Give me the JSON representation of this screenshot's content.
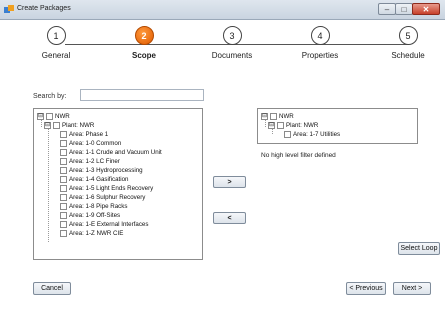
{
  "window": {
    "title": "Create Packages"
  },
  "steps": [
    {
      "number": "1",
      "label": "General"
    },
    {
      "number": "2",
      "label": "Scope"
    },
    {
      "number": "3",
      "label": "Documents"
    },
    {
      "number": "4",
      "label": "Properties"
    },
    {
      "number": "5",
      "label": "Schedule"
    }
  ],
  "active_step": 2,
  "search": {
    "label": "Search by:",
    "value": ""
  },
  "left_tree": {
    "root": "NWR",
    "plant": "Plant: NWR",
    "areas": [
      "Area: Phase 1",
      "Area: 1-0 Common",
      "Area: 1-1 Crude and Vacuum Unit",
      "Area: 1-2 LC Finer",
      "Area: 1-3 Hydroprocessing",
      "Area: 1-4 Gasification",
      "Area: 1-5 Light Ends Recovery",
      "Area: 1-6 Sulphur Recovery",
      "Area: 1-8 Pipe Racks",
      "Area: 1-9 Off-Sites",
      "Area: 1-E External Interfaces",
      "Area: 1-Z NWR CIE"
    ]
  },
  "right_tree": {
    "root": "NWR",
    "plant": "Plant: NWR",
    "area": "Area: 1-7 Utilities"
  },
  "filter_message": "No high level filter defined",
  "buttons": {
    "move_right": ">",
    "move_left": "<",
    "select_loop": "Select Loop",
    "cancel": "Cancel",
    "previous": "< Previous",
    "next": "Next >"
  },
  "icons": {
    "expander_open": "⊟",
    "minimize": "–",
    "maximize": "□",
    "close": "✕"
  },
  "colors": {
    "active_step": "#e05a00"
  }
}
